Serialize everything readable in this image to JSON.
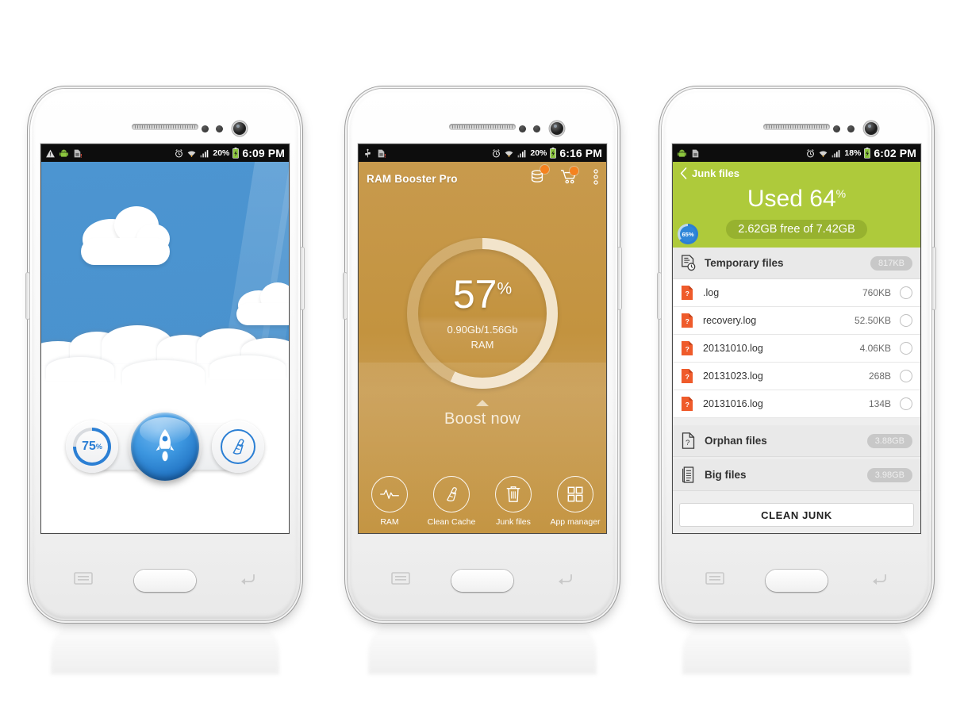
{
  "phones": [
    {
      "id": "phone-launcher",
      "statusbar": {
        "left_icons": [
          "warning-icon",
          "android-icon",
          "sim-card-icon"
        ],
        "right_icons": [
          "alarm-icon",
          "wifi-icon",
          "signal-icon"
        ],
        "battery": "20%",
        "time": "6:09 PM"
      },
      "wallpaper": "blue-sky-with-clouds",
      "widget": {
        "ram_percent_label": "75",
        "ram_percent_symbol": "%",
        "ram_percent_value": 75,
        "boost_icon": "rocket-icon",
        "clean_icon": "broom-icon"
      }
    },
    {
      "id": "phone-ram-booster",
      "statusbar": {
        "left_icons": [
          "usb-icon",
          "sim-card-icon"
        ],
        "right_icons": [
          "alarm-icon",
          "wifi-icon",
          "signal-icon"
        ],
        "battery": "20%",
        "time": "6:16 PM"
      },
      "appbar": {
        "title": "RAM Booster Pro",
        "actions": [
          "storage-icon",
          "cart-icon",
          "overflow-menu-icon"
        ]
      },
      "gauge": {
        "percent_label": "57",
        "percent_symbol": "%",
        "percent_value": 57,
        "usage": "0.90Gb/1.56Gb",
        "unit_label": "RAM"
      },
      "boost": {
        "label": "Boost now",
        "caret": "caret-up-icon"
      },
      "bottom_nav": [
        {
          "label": "RAM",
          "icon": "pulse-icon"
        },
        {
          "label": "Clean Cache",
          "icon": "broom-icon"
        },
        {
          "label": "Junk files",
          "icon": "trash-icon"
        },
        {
          "label": "App manager",
          "icon": "grid-icon"
        }
      ]
    },
    {
      "id": "phone-junk-files",
      "statusbar": {
        "left_icons": [
          "android-icon",
          "sim-card-icon"
        ],
        "right_icons": [
          "alarm-icon",
          "wifi-icon",
          "signal-icon"
        ],
        "battery": "18%",
        "time": "6:02 PM"
      },
      "titlebar": {
        "back_icon": "chevron-left-icon",
        "title": "Junk files"
      },
      "storage_header": {
        "used_label": "Used 64",
        "used_symbol": "%",
        "used_percent": 64,
        "free_text": "2.62GB free of 7.42GB",
        "badge_label": "65%",
        "badge_percent": 65
      },
      "groups": [
        {
          "name": "Temporary files",
          "icon": "document-clock-icon",
          "size": "817KB",
          "files": [
            {
              "name": ".log",
              "size": "760KB",
              "icon": "unknown-file-icon"
            },
            {
              "name": "recovery.log",
              "size": "52.50KB",
              "icon": "unknown-file-icon"
            },
            {
              "name": "20131010.log",
              "size": "4.06KB",
              "icon": "unknown-file-icon"
            },
            {
              "name": "20131023.log",
              "size": "268B",
              "icon": "unknown-file-icon"
            },
            {
              "name": "20131016.log",
              "size": "134B",
              "icon": "unknown-file-icon"
            }
          ]
        },
        {
          "name": "Orphan files",
          "icon": "question-document-icon",
          "size": "3.88GB",
          "files": []
        },
        {
          "name": "Big files",
          "icon": "lines-document-icon",
          "size": "3.98GB",
          "files": []
        }
      ],
      "clean_button": "CLEAN JUNK"
    }
  ],
  "colors": {
    "sky_blue": "#4a92ce",
    "accent_blue": "#2b7fd4",
    "gold": "#c3933f",
    "green": "#aeca3b",
    "orange_badge": "#f5821f",
    "file_orange": "#ef5b2b"
  }
}
